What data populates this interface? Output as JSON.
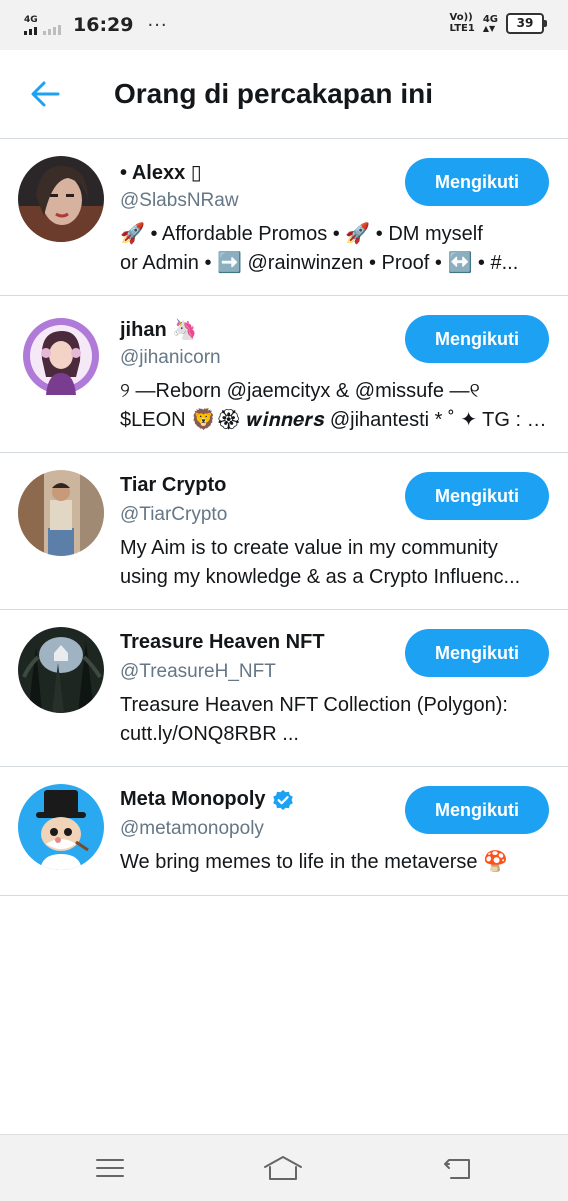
{
  "status_bar": {
    "network_left": "4G",
    "time": "16:29",
    "dots": "···",
    "volte": "Vo))",
    "lte": "LTE1",
    "network_right": "4G",
    "battery": "39"
  },
  "header": {
    "back_icon": "arrow-left-icon",
    "title": "Orang di percakapan ini"
  },
  "accent_color": "#1da1f2",
  "users": [
    {
      "name": "• Alexx ▯",
      "handle": "@SlabsNRaw",
      "bio_line1": "🚀 • Affordable Promos • 🚀 • DM myself",
      "bio_line2": "or Admin • ➡️ @rainwinzen • Proof • ↔️ • #...",
      "button": "Mengikuti",
      "verified": false
    },
    {
      "name": "jihan 🦄",
      "handle": "@jihanicorn",
      "bio_line1": "୨ ―Reborn @jaemcityx & @missufe ―୧",
      "bio_line2": "$LEON 🦁🏵 𝒘𝒊𝒏𝒏𝒆𝒓𝒔 @jihantesti * ˚ ✦ TG : t....",
      "button": "Mengikuti",
      "verified": false
    },
    {
      "name": "Tiar Crypto",
      "handle": "@TiarCrypto",
      "bio_line1": "My Aim is to create value in my community",
      "bio_line2": "using my knowledge & as a Crypto Influenc...",
      "button": "Mengikuti",
      "verified": false
    },
    {
      "name": "Treasure Heaven NFT",
      "handle": "@TreasureH_NFT",
      "bio_line1": "Treasure Heaven NFT Collection (Polygon):",
      "bio_line2": "cutt.ly/ONQ8RBR ...",
      "button": "Mengikuti",
      "verified": false
    },
    {
      "name": "Meta Monopoly",
      "handle": "@metamonopoly",
      "bio_line1": "We bring memes to life in the metaverse 🍄",
      "bio_line2": "",
      "button": "Mengikuti",
      "verified": true
    }
  ],
  "nav_bar": {
    "menu_icon": "menu-icon",
    "home_icon": "home-icon",
    "back_icon": "return-icon"
  }
}
